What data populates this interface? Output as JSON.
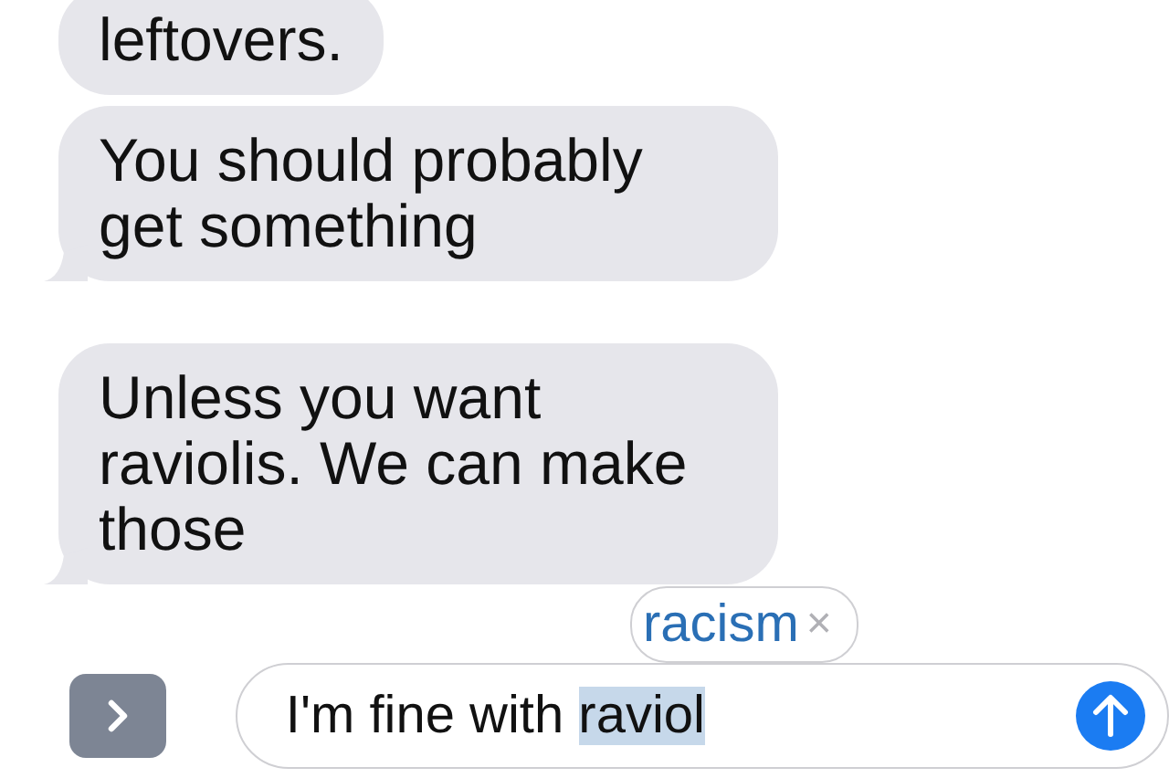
{
  "messages": [
    {
      "text": "leftovers.",
      "tail": false
    },
    {
      "text": "You should probably get something",
      "tail": true
    },
    {
      "text": "Unless you want raviolis. We can make those",
      "tail": true
    }
  ],
  "suggestion": {
    "text": "racism",
    "dismiss": "×"
  },
  "input": {
    "parts": [
      {
        "text": "I'm fine with ",
        "selected": false
      },
      {
        "text": "raviol",
        "selected": true
      }
    ]
  }
}
